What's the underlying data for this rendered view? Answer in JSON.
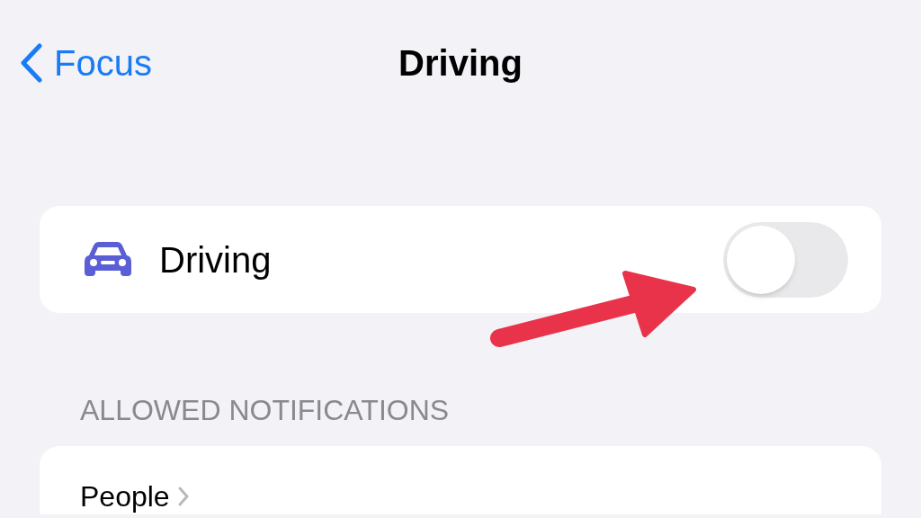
{
  "nav": {
    "back_label": "Focus",
    "title": "Driving"
  },
  "focus_card": {
    "label": "Driving",
    "on": false
  },
  "section": {
    "header": "ALLOWED NOTIFICATIONS",
    "rows": [
      {
        "label": "People"
      }
    ]
  }
}
